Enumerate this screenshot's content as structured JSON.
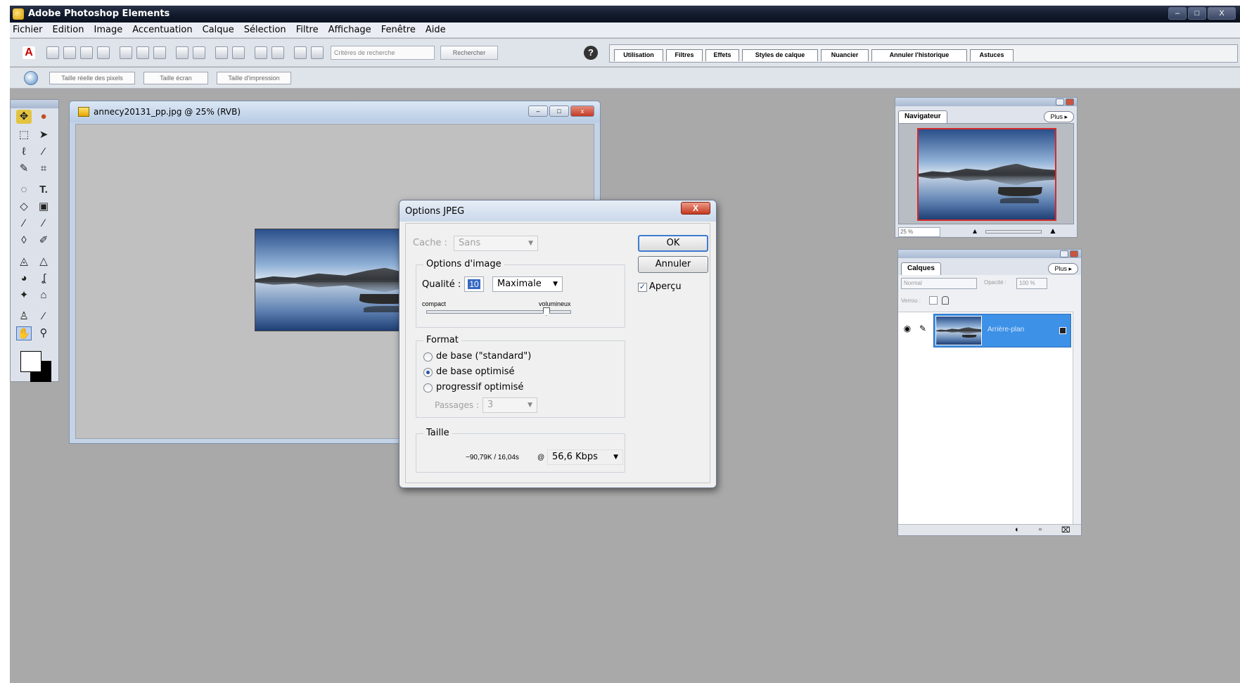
{
  "app": {
    "title": "Adobe Photoshop Elements",
    "window_buttons": [
      "–",
      "□",
      "X"
    ]
  },
  "menu": [
    "Fichier",
    "Edition",
    "Image",
    "Accentuation",
    "Calque",
    "Sélection",
    "Filtre",
    "Affichage",
    "Fenêtre",
    "Aide"
  ],
  "toolbar": {
    "search_placeholder": "Critères de recherche",
    "search_button": "Rechercher",
    "help_label": "?",
    "palette_tabs": [
      "Utilisation",
      "Filtres",
      "Effets",
      "Styles de calque",
      "Nuancier",
      "Annuler l'historique",
      "Astuces"
    ]
  },
  "options_bar": {
    "buttons": [
      "Taille réelle des pixels",
      "Taille écran",
      "Taille d'impression"
    ]
  },
  "document": {
    "title": "annecy20131_pp.jpg @ 25% (RVB)",
    "buttons": [
      "–",
      "□",
      "x"
    ]
  },
  "dialog": {
    "title": "Options JPEG",
    "close_label": "X",
    "matte_label": "Cache :",
    "matte_value": "Sans",
    "image_options_title": "Options d'image",
    "quality_label": "Qualité :",
    "quality_value": "10",
    "quality_preset": "Maximale",
    "slider_min_label": "compact",
    "slider_max_label": "volumineux",
    "quality_slider_fraction": 0.83,
    "format_title": "Format",
    "format_options": [
      "de base (\"standard\")",
      "de base optimisé",
      "progressif optimisé"
    ],
    "format_selected_index": 1,
    "passes_label": "Passages :",
    "passes_value": "3",
    "size_title": "Taille",
    "size_value": "~90,79K / 16,04s",
    "size_at": "@",
    "speed_value": "56,6 Kbps",
    "ok_label": "OK",
    "cancel_label": "Annuler",
    "preview_label": "Aperçu",
    "preview_checked": true
  },
  "navigator": {
    "tab": "Navigateur",
    "more": "Plus ▸",
    "zoom": "25 %"
  },
  "layers": {
    "tab": "Calques",
    "more": "Plus ▸",
    "mode": "Normal",
    "opacity_label": "Opacité :",
    "opacity_value": "100 %",
    "lock_label": "Verrou :",
    "layer_name": "Arrière-plan"
  },
  "colors": {
    "workspace": "#a9a9a9",
    "selection_blue": "#3d91e6",
    "nav_frame_red": "#d32b2b"
  }
}
